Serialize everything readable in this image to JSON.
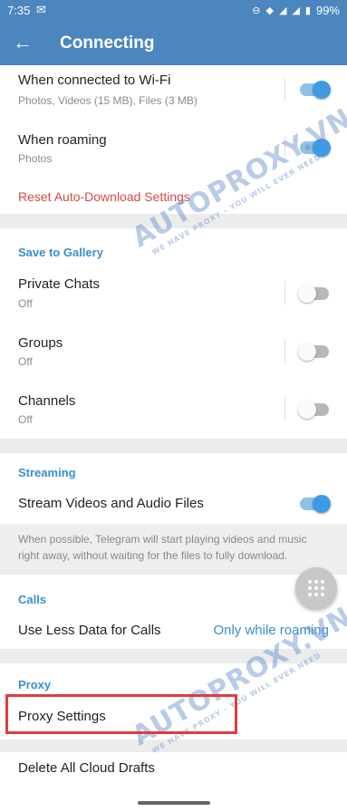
{
  "status_bar": {
    "time": "7:35",
    "battery": "99%"
  },
  "toolbar": {
    "title": "Connecting"
  },
  "auto_download": {
    "wifi_title": "When connected to Wi-Fi",
    "wifi_sub": "Photos, Videos (15 MB), Files (3 MB)",
    "wifi_on": true,
    "roaming_title": "When roaming",
    "roaming_sub": "Photos",
    "roaming_on": true,
    "reset_label": "Reset Auto-Download Settings"
  },
  "gallery": {
    "header": "Save to Gallery",
    "items": [
      {
        "title": "Private Chats",
        "sub": "Off",
        "on": false
      },
      {
        "title": "Groups",
        "sub": "Off",
        "on": false
      },
      {
        "title": "Channels",
        "sub": "Off",
        "on": false
      }
    ]
  },
  "streaming": {
    "header": "Streaming",
    "stream_title": "Stream Videos and Audio Files",
    "stream_on": true,
    "info": "When possible, Telegram will start playing videos and music right away, without waiting for the files to fully download."
  },
  "calls": {
    "header": "Calls",
    "title": "Use Less Data for Calls",
    "value": "Only while roaming"
  },
  "proxy": {
    "header": "Proxy",
    "settings_label": "Proxy Settings"
  },
  "drafts": {
    "label": "Delete All Cloud Drafts"
  },
  "watermark": {
    "brand": "AUTOPROXY.VN",
    "tagline": "WE HAVE PROXY - YOU WILL EVER NEED"
  },
  "colors": {
    "primary": "#4b86be",
    "accent": "#3a8fce",
    "danger": "#d24a4a"
  }
}
